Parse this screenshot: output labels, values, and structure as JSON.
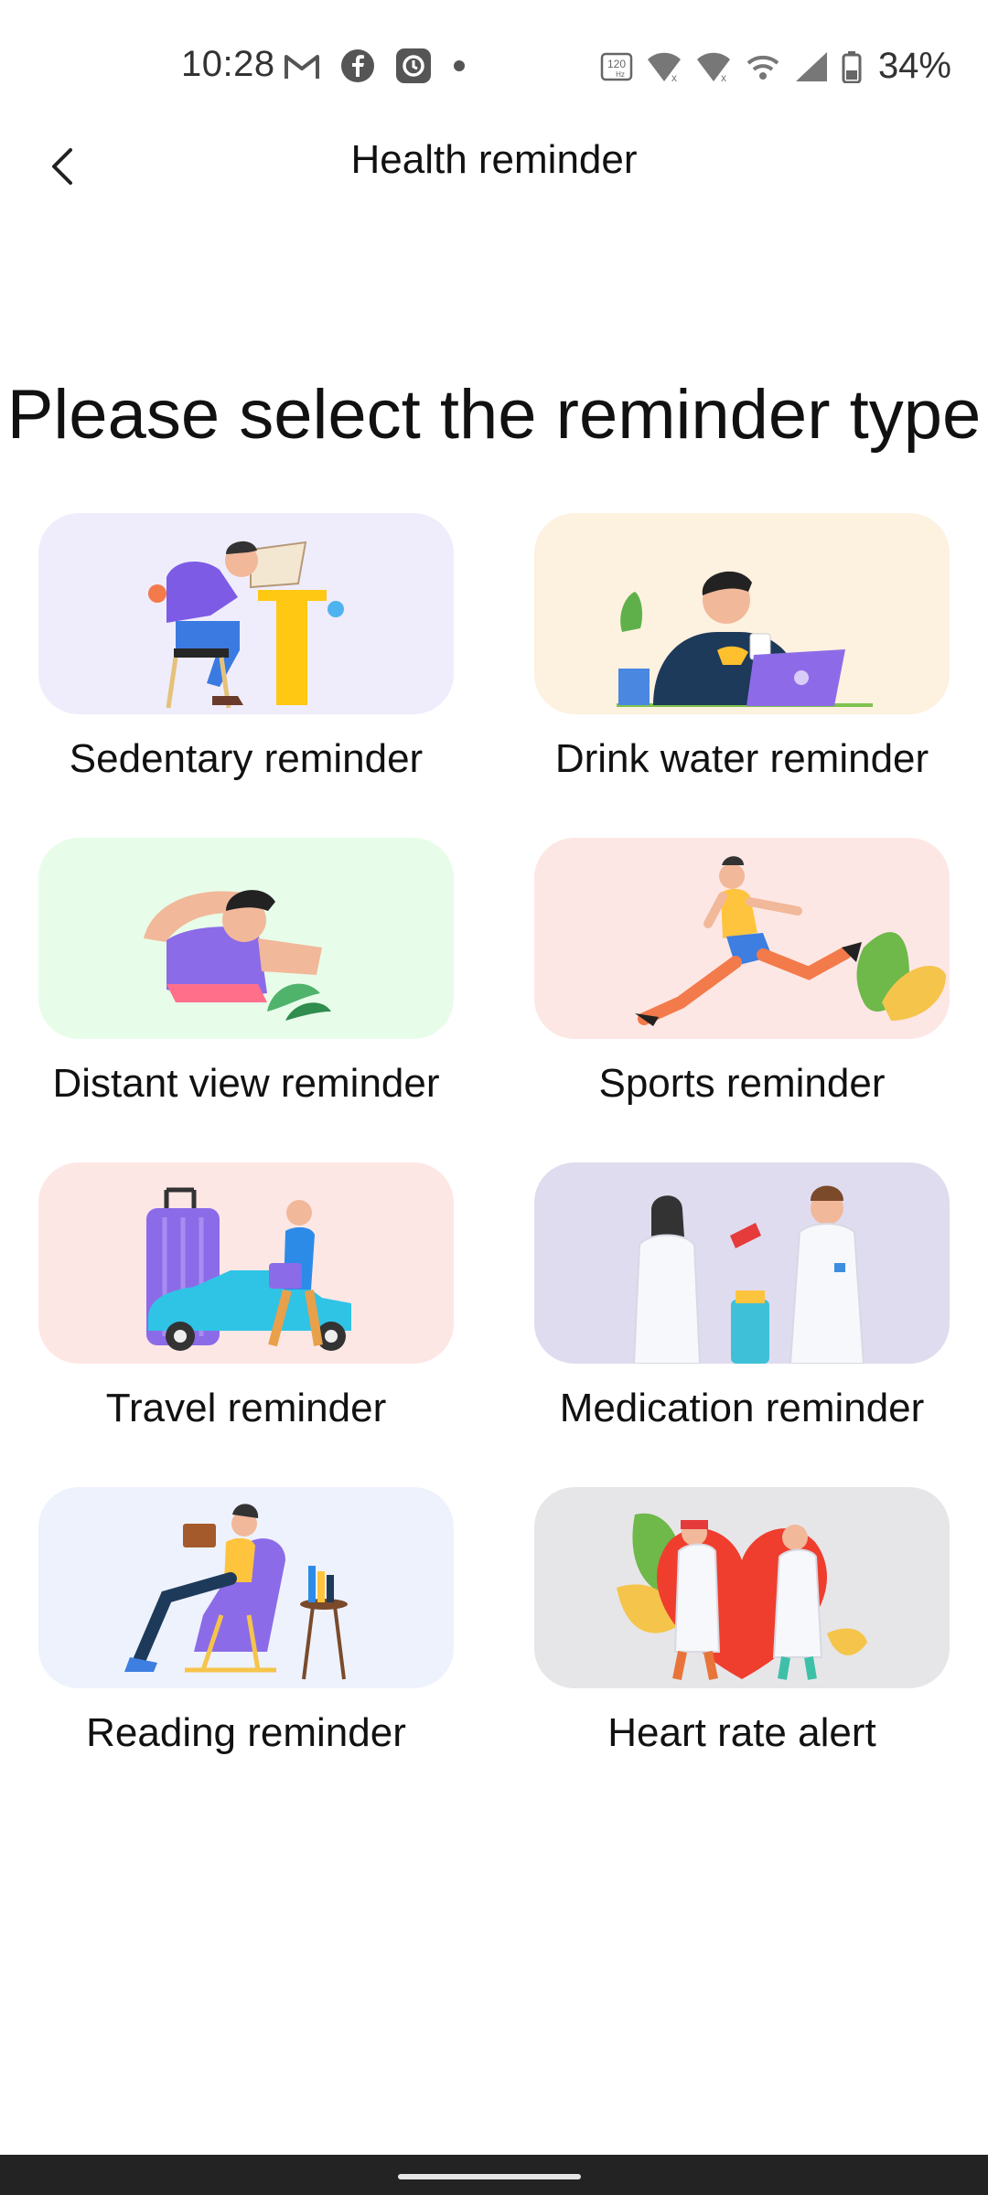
{
  "status_bar": {
    "time": "10:28",
    "battery_percent": "34%",
    "refresh_rate": "120 Hz",
    "left_icons": [
      "gmail-icon",
      "facebook-icon",
      "threads-icon",
      "dot-icon"
    ],
    "right_icons": [
      "refresh-rate-icon",
      "wifi-calling-icon",
      "wifi-calling-icon",
      "hotspot-icon",
      "cellular-signal-icon",
      "battery-icon"
    ]
  },
  "header": {
    "title": "Health reminder",
    "back_icon": "chevron-left-icon"
  },
  "page": {
    "heading": "Please select the reminder type"
  },
  "reminders": [
    {
      "label": "Sedentary reminder",
      "bg": "#efedfc"
    },
    {
      "label": "Drink water reminder",
      "bg": "#fdf1df"
    },
    {
      "label": "Distant view reminder",
      "bg": "#e8fde9"
    },
    {
      "label": "Sports reminder",
      "bg": "#fde7e5"
    },
    {
      "label": "Travel reminder",
      "bg": "#fde7e5"
    },
    {
      "label": "Medication reminder",
      "bg": "#e0dcef"
    },
    {
      "label": "Reading reminder",
      "bg": "#eef2fd"
    },
    {
      "label": "Heart rate alert",
      "bg": "#e6e6e8"
    }
  ],
  "colors": {
    "nav_bar": "#232323",
    "text": "#111111"
  }
}
